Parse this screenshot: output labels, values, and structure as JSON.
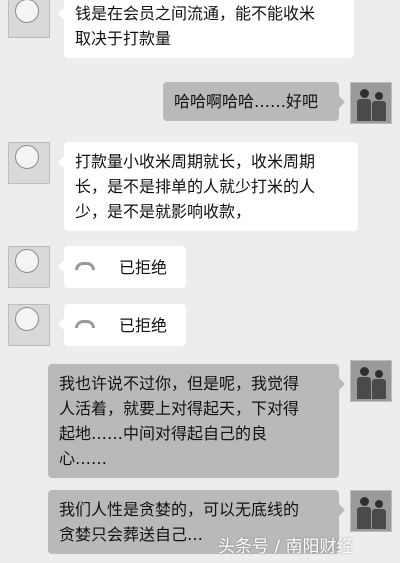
{
  "messages": [
    {
      "side": "left",
      "lines": [
        "钱是在会员之间流通，能不能收米",
        "取决于打款量"
      ]
    },
    {
      "side": "right",
      "lines": [
        "哈哈啊哈哈……好吧"
      ]
    },
    {
      "side": "left",
      "lines": [
        "打款量小收米周期就长，收米周期",
        "长，是不是排单的人就少打米的人",
        "少，是不是就影响收款，"
      ]
    },
    {
      "side": "left",
      "call": true,
      "text": "已拒绝"
    },
    {
      "side": "left",
      "call": true,
      "text": "已拒绝"
    },
    {
      "side": "right",
      "lines": [
        "我也许说不过你，但是呢，我觉得",
        "人活着，就要上对得起天，下对得",
        "起地……中间对得起自己的良",
        "心……"
      ]
    },
    {
      "side": "right",
      "lines": [
        "我们人性是贪婪的，可以无底线的",
        "贪婪只会葬送自己…"
      ]
    }
  ],
  "watermark": "头条号 / 南阳财经",
  "colors": {
    "background": "#ededed",
    "left_bubble": "#ffffff",
    "right_bubble": "#b9b9b9"
  }
}
